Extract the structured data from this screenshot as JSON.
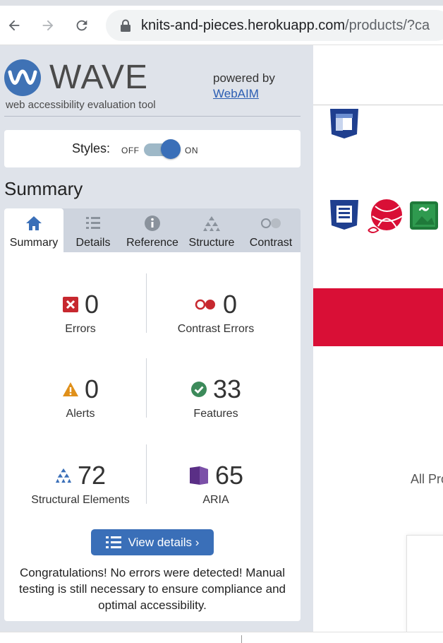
{
  "browser": {
    "url_host": "knits-and-pieces.herokuapp.com",
    "url_path": "/products/?ca"
  },
  "wave": {
    "logo_text": "WAVE",
    "tagline": "web accessibility evaluation tool",
    "powered_by": "powered by",
    "webaim_link": "WebAIM",
    "styles_label": "Styles:",
    "styles_off": "OFF",
    "styles_on": "ON",
    "styles_enabled": true,
    "summary_heading": "Summary",
    "tabs": [
      {
        "label": "Summary",
        "icon": "home-icon",
        "active": true
      },
      {
        "label": "Details",
        "icon": "list-icon",
        "active": false
      },
      {
        "label": "Reference",
        "icon": "info-icon",
        "active": false
      },
      {
        "label": "Structure",
        "icon": "hierarchy-icon",
        "active": false
      },
      {
        "label": "Contrast",
        "icon": "contrast-icon",
        "active": false
      }
    ],
    "stats": {
      "errors": {
        "count": "0",
        "label": "Errors"
      },
      "contrast_errors": {
        "count": "0",
        "label": "Contrast Errors"
      },
      "alerts": {
        "count": "0",
        "label": "Alerts"
      },
      "features": {
        "count": "33",
        "label": "Features"
      },
      "structural": {
        "count": "72",
        "label": "Structural Elements"
      },
      "aria": {
        "count": "65",
        "label": "ARIA"
      }
    },
    "view_details": "View details ›",
    "congrats": "Congratulations! No errors were detected! Manual testing is still necessary to ensure compliance and optimal accessibility."
  },
  "page": {
    "all_products_partial": "All Pro"
  },
  "colors": {
    "wave_blue": "#3a6fb8",
    "error_red": "#c7282f",
    "alert_orange": "#e0901a",
    "feature_green": "#3c8a5a",
    "aria_purple": "#5a2f86",
    "brand_red": "#d90f36"
  }
}
